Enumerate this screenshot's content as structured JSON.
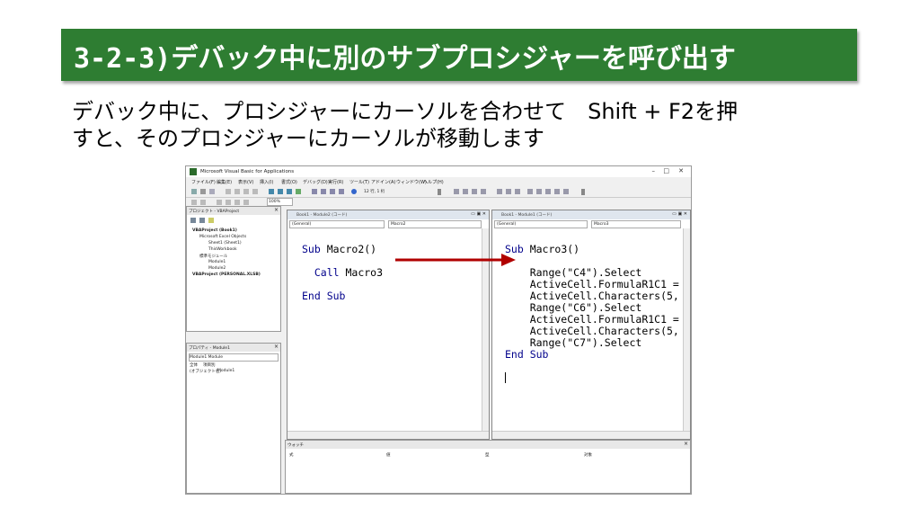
{
  "slide": {
    "title": "3-2-3)デバック中に別のサブプロシジャーを呼び出す",
    "subtitle_line1": "デバック中に、プロシジャーにカーソルを合わせて　Shift + F2を押",
    "subtitle_line2": "すと、そのプロシジャーにカーソルが移動します"
  },
  "window": {
    "title": "Microsoft Visual Basic for Applications",
    "controls": [
      "–",
      "□",
      "✕"
    ],
    "menus": [
      "ファイル(F)",
      "編集(E)",
      "表示(V)",
      "挿入(I)",
      "書式(O)",
      "デバッグ(D)",
      "実行(R)",
      "ツール(T)",
      "アドイン(A)",
      "ウィンドウ(W)",
      "ヘルプ(H)"
    ],
    "position_status": "12 行, 1 桁",
    "zoom": "100%"
  },
  "project": {
    "title": "プロジェクト - VBAProject",
    "items": [
      "VBAProject (Book1)",
      "Microsoft Excel Objects",
      "Sheet1 (Sheet1)",
      "ThisWorkbook",
      "標準モジュール",
      "Module1",
      "Module2",
      "VBAProject (PERSONAL.XLSB)"
    ]
  },
  "properties": {
    "title": "プロパティ - Module1",
    "object": "Module1 Module",
    "tabs": [
      "全体",
      "項目別"
    ],
    "row_name": "(オブジェクト名)",
    "row_value": "Module1"
  },
  "code_left": {
    "title": "Book1 - Module2 (コード)",
    "combo_general": "(General)",
    "combo_proc": "Macro2",
    "lines": [
      "Sub Macro2()",
      "",
      "  Call Macro3",
      "",
      "End Sub"
    ]
  },
  "code_right": {
    "title": "Book1 - Module1 (コード)",
    "combo_general": "(General)",
    "combo_proc": "Macro3",
    "lines": [
      "Sub Macro3()",
      "",
      "    Range(\"C4\").Select",
      "    ActiveCell.FormulaR1C1 =",
      "    ActiveCell.Characters(5,",
      "    Range(\"C6\").Select",
      "    ActiveCell.FormulaR1C1 =",
      "    ActiveCell.Characters(5,",
      "    Range(\"C7\").Select",
      "End Sub"
    ]
  },
  "watch": {
    "title": "ウォッチ",
    "columns": [
      "式",
      "値",
      "型",
      "対象"
    ]
  },
  "colors": {
    "title_bg": "#2e7d32",
    "arrow": "#b00000"
  }
}
